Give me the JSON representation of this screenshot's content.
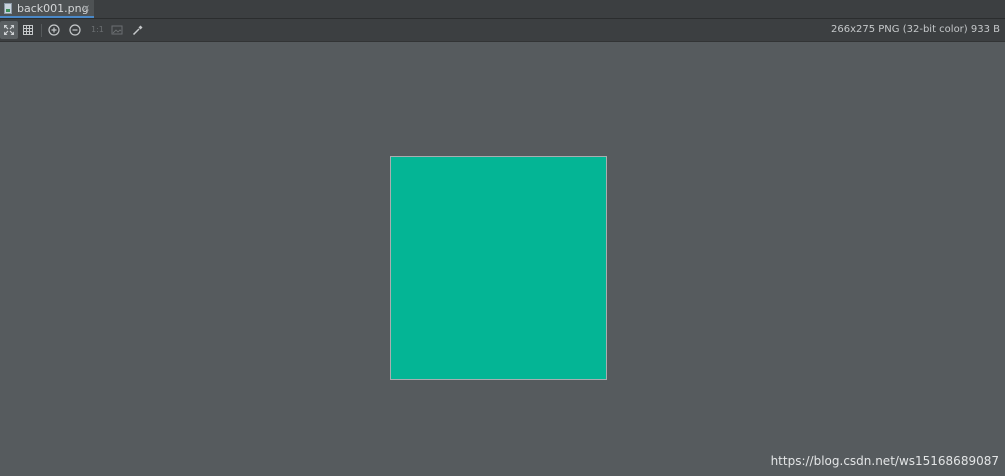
{
  "tab": {
    "label": "back001.png",
    "close_glyph": "×",
    "icon": "image-file-icon"
  },
  "toolbar": {
    "buttons": [
      {
        "name": "fit-to-window-button",
        "icon": "fit-to-window-icon",
        "active": true
      },
      {
        "name": "grid-button",
        "icon": "grid-icon",
        "active": false
      },
      {
        "name": "zoom-in-button",
        "icon": "zoom-in-icon",
        "active": false
      },
      {
        "name": "zoom-out-button",
        "icon": "zoom-out-icon",
        "active": false
      },
      {
        "name": "actual-size-button",
        "label": "1:1",
        "active": false,
        "disabled": true
      },
      {
        "name": "background-button",
        "icon": "background-icon",
        "active": false,
        "disabled": true
      },
      {
        "name": "color-picker-button",
        "icon": "eyedropper-icon",
        "active": false
      }
    ],
    "actual_size_label": "1:1",
    "image_info": "266x275 PNG (32-bit color) 933 B"
  },
  "image": {
    "fill_color": "#04b595"
  },
  "watermark": "https://blog.csdn.net/ws15168689087",
  "colors": {
    "background": "#565b5e",
    "toolbar": "#3c3f41",
    "tab_accent": "#4a88c7"
  }
}
